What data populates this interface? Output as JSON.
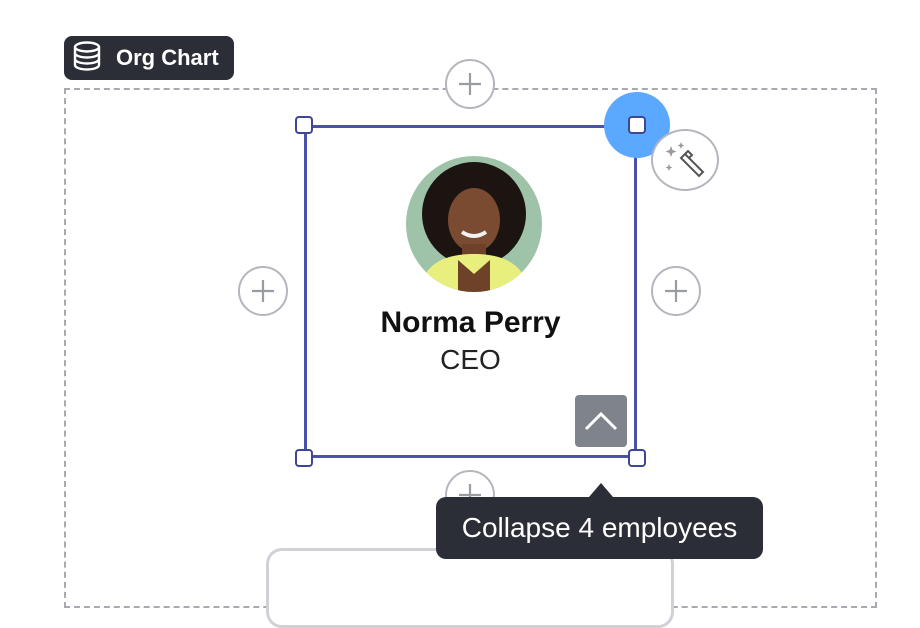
{
  "badge": {
    "label": "Org Chart",
    "icon": "database-icon"
  },
  "node": {
    "name": "Norma Perry",
    "title": "CEO"
  },
  "tooltip": {
    "text": "Collapse 4 employees"
  },
  "colors": {
    "selection": "#4a52a8",
    "accent_dot": "#5aa8ff",
    "dark_ui": "#2b2e36",
    "collapse_button": "#7f838b"
  }
}
